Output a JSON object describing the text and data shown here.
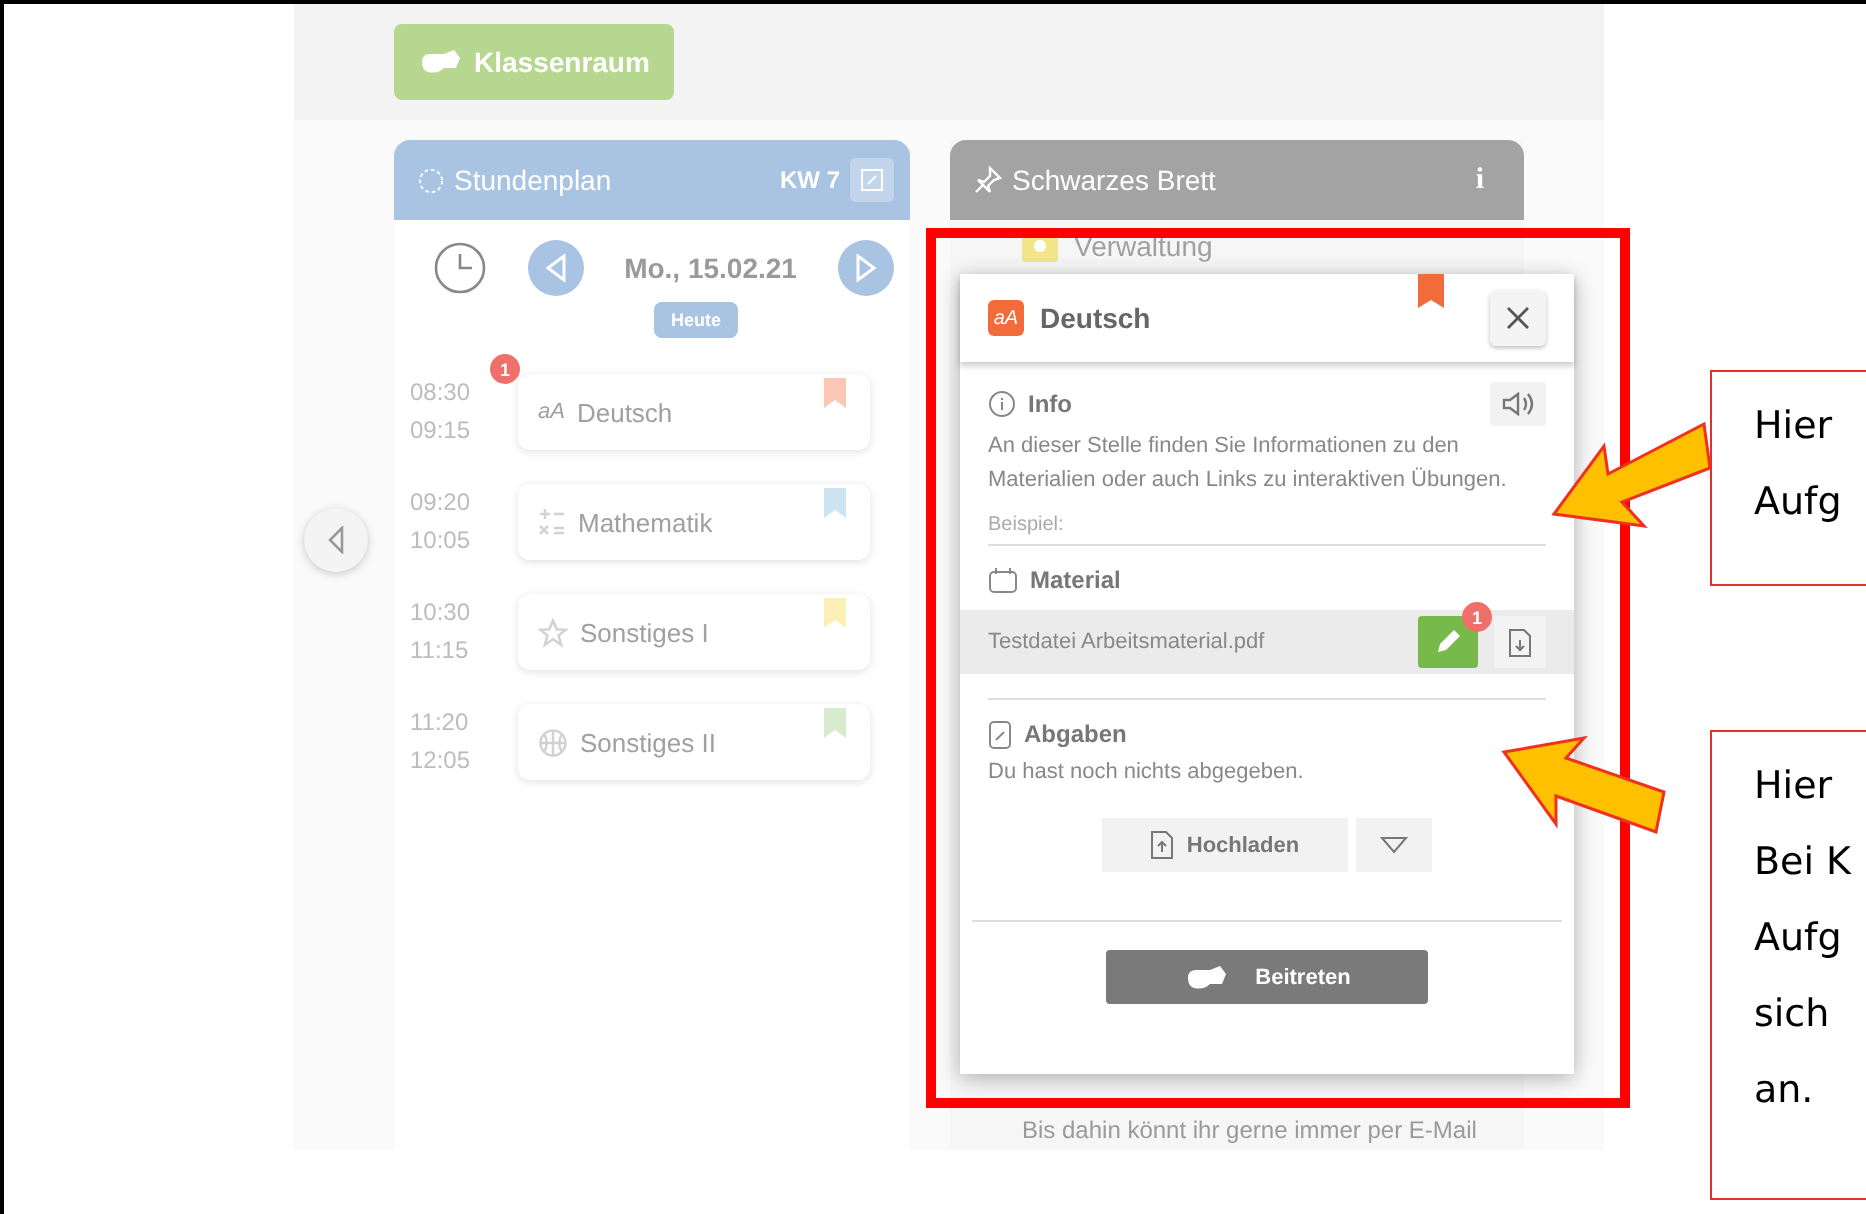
{
  "classroom_button": {
    "label": "Klassenraum"
  },
  "schedule": {
    "title": "Stundenplan",
    "week": "KW 7",
    "date": "Mo., 15.02.21",
    "today_button": "Heute",
    "lessons": [
      {
        "start": "08:30",
        "end": "09:15",
        "subject": "Deutsch",
        "kind": "letters",
        "glyph": "aA",
        "badge": "1",
        "color": "#fbc6b4"
      },
      {
        "start": "09:20",
        "end": "10:05",
        "subject": "Mathematik",
        "kind": "math",
        "color": "#cde4f2"
      },
      {
        "start": "10:30",
        "end": "11:15",
        "subject": "Sonstiges I",
        "kind": "star",
        "color": "#fdf0b6"
      },
      {
        "start": "11:20",
        "end": "12:05",
        "subject": "Sonstiges II",
        "kind": "ball",
        "color": "#d8ebcd"
      }
    ]
  },
  "board": {
    "title": "Schwarzes Brett",
    "info_glyph": "i",
    "first_item": "Verwaltung",
    "notice": "Bis dahin könnt ihr gerne immer per E-Mail"
  },
  "popup": {
    "glyph": "aA",
    "title": "Deutsch",
    "info": {
      "heading": "Info",
      "text": "An dieser Stelle finden Sie Informationen zu den Materialien oder auch Links zu interaktiven Übungen.",
      "example": "Beispiel:"
    },
    "material": {
      "heading": "Material",
      "file": "Testdatei Arbeitsmaterial.pdf",
      "badge": "1"
    },
    "submissions": {
      "heading": "Abgaben",
      "text": "Du hast noch nichts abgegeben.",
      "upload_button": "Hochladen"
    },
    "join_button": "Beitreten"
  },
  "callouts": [
    {
      "text": "Hier\nAufg"
    },
    {
      "text": "Hier\nBei K\nAufg\nsich\nan."
    }
  ]
}
